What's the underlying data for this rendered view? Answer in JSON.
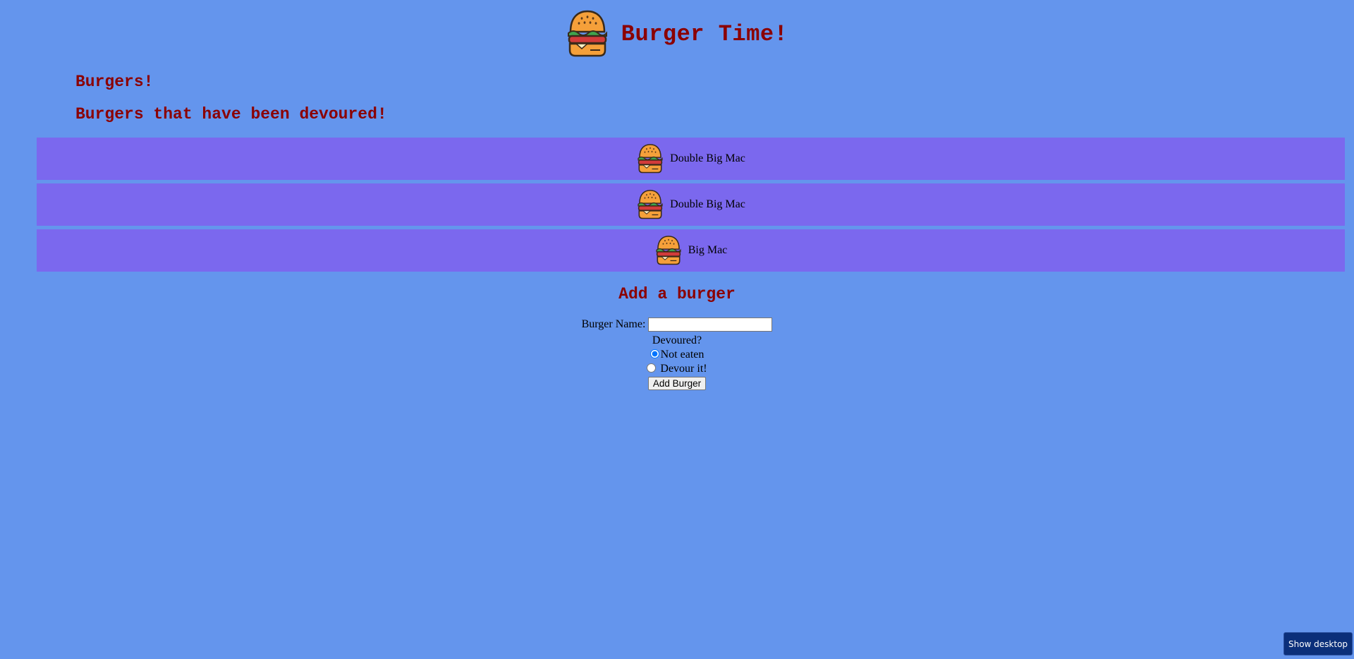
{
  "header": {
    "title": "Burger Time!",
    "logo_icon": "burger-icon"
  },
  "sections": {
    "burgers_title": "Burgers!",
    "devoured_title": "Burgers that have been devoured!"
  },
  "devoured_burgers": [
    {
      "name": "Double Big Mac",
      "icon": "burger-icon"
    },
    {
      "name": "Double Big Mac",
      "icon": "burger-icon"
    },
    {
      "name": "Big Mac",
      "icon": "burger-icon"
    }
  ],
  "add_form": {
    "title": "Add a burger",
    "name_label": "Burger Name:",
    "name_value": "",
    "devoured_label": "Devoured?",
    "options": [
      {
        "label": "Not eaten",
        "checked": true
      },
      {
        "label": "Devour it!",
        "checked": false
      }
    ],
    "submit_label": "Add Burger"
  },
  "taskbar": {
    "show_desktop_label": "Show desktop"
  },
  "colors": {
    "background": "#6495ed",
    "row_background": "#7b68ee",
    "heading": "#8b0000",
    "bun": "#f5a03a",
    "lettuce": "#3fa34d",
    "patty": "#d23b3b"
  }
}
